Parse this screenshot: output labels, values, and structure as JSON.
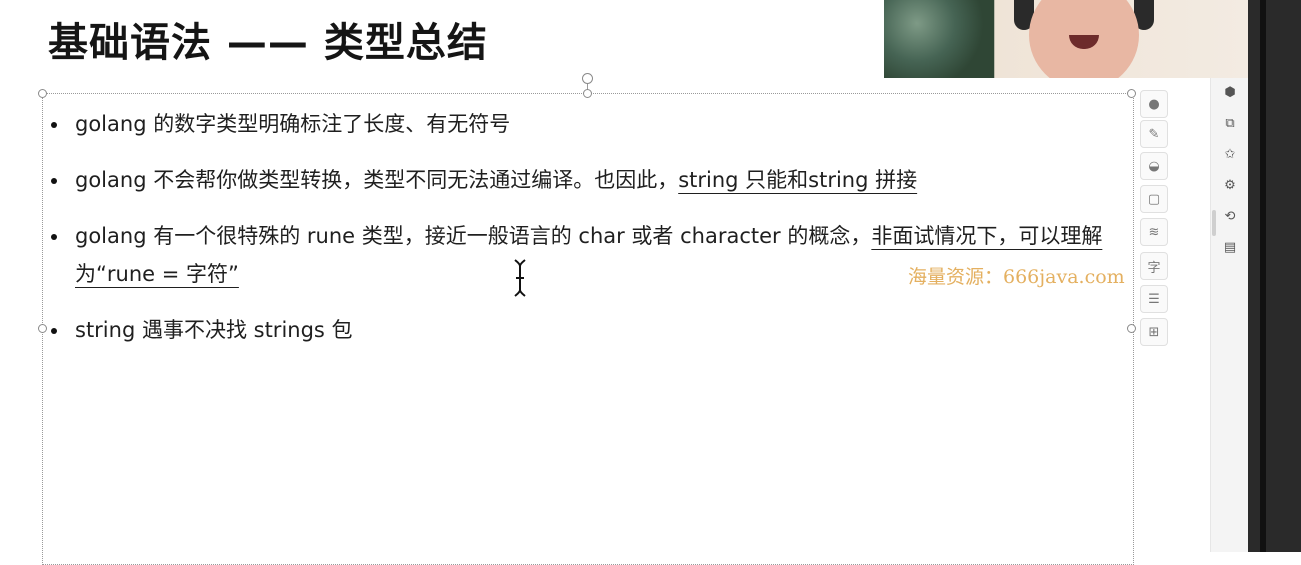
{
  "slide": {
    "title": "基础语法 —— 类型总结"
  },
  "bullets": [
    {
      "pre": "golang 的数字类型明确标注了长度、有无符号",
      "underlined": ""
    },
    {
      "pre": "golang 不会帮你做类型转换，类型不同无法通过编译。也因此，",
      "underlined": "string 只能和string 拼接"
    },
    {
      "pre": "golang 有一个很特殊的 rune 类型，接近一般语言的 char 或者 character 的概念，",
      "underlined": "非面试情况下，可以理解为“rune = 字符”"
    },
    {
      "pre": "string 遇事不决找 strings 包",
      "underlined": ""
    }
  ],
  "watermark": "海量资源：666java.com",
  "tools": [
    "collapse-icon",
    "pen-icon",
    "fill-icon",
    "border-icon",
    "layers-icon",
    "text-icon",
    "align-icon",
    "more-icon"
  ],
  "panel_icons": [
    "property-icon",
    "copy-icon",
    "pin-icon",
    "settings-icon",
    "history-icon",
    "image-icon"
  ],
  "colors": {
    "watermark": "#e4b060",
    "accent": "#3b82f6"
  }
}
